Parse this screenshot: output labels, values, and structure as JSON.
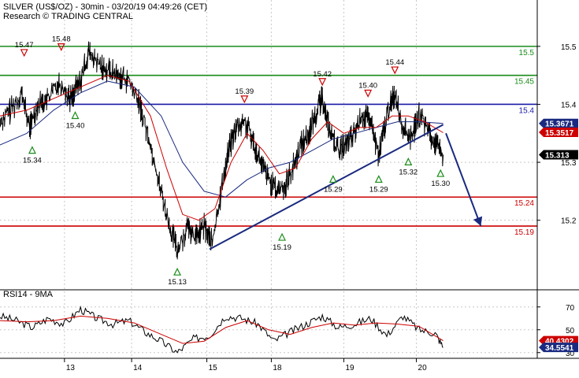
{
  "chart_data": {
    "type": "line",
    "title": "SILVER (US$/OZ) - 30min - 03/20/19 04:49:26 (CET)",
    "subtitle": "Research © TRADING CENTRAL",
    "price_panel": {
      "ylim": [
        15.08,
        15.58
      ],
      "y_ticks": [
        {
          "value": 15.5,
          "label": "15.5"
        },
        {
          "value": 15.4,
          "label": "15.4"
        },
        {
          "value": 15.3,
          "label": "15.3"
        },
        {
          "value": 15.2,
          "label": "15.2"
        }
      ],
      "levels": [
        {
          "value": 15.5,
          "label": "15.5",
          "color": "#1a8c1a"
        },
        {
          "value": 15.45,
          "label": "15.45",
          "color": "#1a8c1a"
        },
        {
          "value": 15.4,
          "label": "15.4",
          "color": "#1a1aa8"
        },
        {
          "value": 15.24,
          "label": "15.24",
          "color": "#cc0000"
        },
        {
          "value": 15.19,
          "label": "15.19",
          "color": "#cc0000"
        }
      ],
      "price_tags": [
        {
          "value": 15.3671,
          "label": "15.3671",
          "bg": "#1a2a80",
          "fg": "#ffffff"
        },
        {
          "value": 15.3517,
          "label": "15.3517",
          "bg": "#cc0000",
          "fg": "#ffffff"
        },
        {
          "value": 15.313,
          "label": "15.313",
          "bg": "#000000",
          "fg": "#ffffff"
        }
      ],
      "annotations": [
        {
          "label": "15.47",
          "type": "high",
          "x": 0.045,
          "price": 15.47
        },
        {
          "label": "15.48",
          "type": "high",
          "x": 0.114,
          "price": 15.48
        },
        {
          "label": "15.40",
          "type": "low",
          "x": 0.14,
          "price": 15.4
        },
        {
          "label": "15.34",
          "type": "low",
          "x": 0.06,
          "price": 15.34
        },
        {
          "label": "15.13",
          "type": "low",
          "x": 0.33,
          "price": 15.13
        },
        {
          "label": "15.39",
          "type": "high",
          "x": 0.455,
          "price": 15.39
        },
        {
          "label": "15.19",
          "type": "low",
          "x": 0.525,
          "price": 15.19
        },
        {
          "label": "15.42",
          "type": "high",
          "x": 0.6,
          "price": 15.42
        },
        {
          "label": "15.29",
          "type": "low",
          "x": 0.62,
          "price": 15.29
        },
        {
          "label": "15.40",
          "type": "high",
          "x": 0.685,
          "price": 15.4
        },
        {
          "label": "15.29",
          "type": "low",
          "x": 0.705,
          "price": 15.29
        },
        {
          "label": "15.44",
          "type": "high",
          "x": 0.735,
          "price": 15.44
        },
        {
          "label": "15.32",
          "type": "low",
          "x": 0.76,
          "price": 15.32
        },
        {
          "label": "15.30",
          "type": "low",
          "x": 0.82,
          "price": 15.3
        }
      ],
      "trendline": {
        "x0": 0.39,
        "p0": 15.15,
        "x1": 0.825,
        "p1": 15.365
      },
      "projection": {
        "x0": 0.83,
        "p0": 15.35,
        "x1": 0.895,
        "p1": 15.19
      },
      "price_series": [
        {
          "x": 0.0,
          "p": 15.37
        },
        {
          "x": 0.02,
          "p": 15.39
        },
        {
          "x": 0.04,
          "p": 15.42
        },
        {
          "x": 0.055,
          "p": 15.36
        },
        {
          "x": 0.07,
          "p": 15.4
        },
        {
          "x": 0.09,
          "p": 15.41
        },
        {
          "x": 0.11,
          "p": 15.44
        },
        {
          "x": 0.13,
          "p": 15.41
        },
        {
          "x": 0.15,
          "p": 15.44
        },
        {
          "x": 0.165,
          "p": 15.49
        },
        {
          "x": 0.18,
          "p": 15.47
        },
        {
          "x": 0.2,
          "p": 15.46
        },
        {
          "x": 0.22,
          "p": 15.45
        },
        {
          "x": 0.24,
          "p": 15.44
        },
        {
          "x": 0.26,
          "p": 15.4
        },
        {
          "x": 0.28,
          "p": 15.33
        },
        {
          "x": 0.3,
          "p": 15.25
        },
        {
          "x": 0.315,
          "p": 15.19
        },
        {
          "x": 0.33,
          "p": 15.15
        },
        {
          "x": 0.35,
          "p": 15.19
        },
        {
          "x": 0.365,
          "p": 15.17
        },
        {
          "x": 0.38,
          "p": 15.19
        },
        {
          "x": 0.395,
          "p": 15.16
        },
        {
          "x": 0.41,
          "p": 15.24
        },
        {
          "x": 0.425,
          "p": 15.32
        },
        {
          "x": 0.44,
          "p": 15.36
        },
        {
          "x": 0.455,
          "p": 15.37
        },
        {
          "x": 0.47,
          "p": 15.34
        },
        {
          "x": 0.485,
          "p": 15.3
        },
        {
          "x": 0.5,
          "p": 15.27
        },
        {
          "x": 0.515,
          "p": 15.25
        },
        {
          "x": 0.53,
          "p": 15.26
        },
        {
          "x": 0.545,
          "p": 15.29
        },
        {
          "x": 0.56,
          "p": 15.33
        },
        {
          "x": 0.575,
          "p": 15.35
        },
        {
          "x": 0.59,
          "p": 15.39
        },
        {
          "x": 0.6,
          "p": 15.41
        },
        {
          "x": 0.615,
          "p": 15.35
        },
        {
          "x": 0.63,
          "p": 15.32
        },
        {
          "x": 0.645,
          "p": 15.33
        },
        {
          "x": 0.66,
          "p": 15.35
        },
        {
          "x": 0.675,
          "p": 15.38
        },
        {
          "x": 0.69,
          "p": 15.37
        },
        {
          "x": 0.705,
          "p": 15.31
        },
        {
          "x": 0.72,
          "p": 15.38
        },
        {
          "x": 0.735,
          "p": 15.42
        },
        {
          "x": 0.75,
          "p": 15.36
        },
        {
          "x": 0.765,
          "p": 15.34
        },
        {
          "x": 0.78,
          "p": 15.38
        },
        {
          "x": 0.795,
          "p": 15.36
        },
        {
          "x": 0.81,
          "p": 15.33
        },
        {
          "x": 0.825,
          "p": 15.313
        }
      ],
      "ma_red": [
        {
          "x": 0.0,
          "p": 15.38
        },
        {
          "x": 0.05,
          "p": 15.39
        },
        {
          "x": 0.1,
          "p": 15.41
        },
        {
          "x": 0.15,
          "p": 15.43
        },
        {
          "x": 0.2,
          "p": 15.45
        },
        {
          "x": 0.24,
          "p": 15.44
        },
        {
          "x": 0.28,
          "p": 15.38
        },
        {
          "x": 0.31,
          "p": 15.29
        },
        {
          "x": 0.34,
          "p": 15.21
        },
        {
          "x": 0.37,
          "p": 15.2
        },
        {
          "x": 0.4,
          "p": 15.22
        },
        {
          "x": 0.43,
          "p": 15.3
        },
        {
          "x": 0.46,
          "p": 15.35
        },
        {
          "x": 0.49,
          "p": 15.32
        },
        {
          "x": 0.52,
          "p": 15.28
        },
        {
          "x": 0.55,
          "p": 15.29
        },
        {
          "x": 0.58,
          "p": 15.34
        },
        {
          "x": 0.61,
          "p": 15.37
        },
        {
          "x": 0.64,
          "p": 15.35
        },
        {
          "x": 0.67,
          "p": 15.36
        },
        {
          "x": 0.7,
          "p": 15.36
        },
        {
          "x": 0.73,
          "p": 15.38
        },
        {
          "x": 0.76,
          "p": 15.38
        },
        {
          "x": 0.79,
          "p": 15.37
        },
        {
          "x": 0.825,
          "p": 15.351
        }
      ],
      "ma_blue": [
        {
          "x": 0.0,
          "p": 15.33
        },
        {
          "x": 0.05,
          "p": 15.35
        },
        {
          "x": 0.1,
          "p": 15.39
        },
        {
          "x": 0.15,
          "p": 15.42
        },
        {
          "x": 0.2,
          "p": 15.44
        },
        {
          "x": 0.25,
          "p": 15.43
        },
        {
          "x": 0.3,
          "p": 15.38
        },
        {
          "x": 0.34,
          "p": 15.3
        },
        {
          "x": 0.38,
          "p": 15.25
        },
        {
          "x": 0.42,
          "p": 15.24
        },
        {
          "x": 0.46,
          "p": 15.27
        },
        {
          "x": 0.5,
          "p": 15.29
        },
        {
          "x": 0.54,
          "p": 15.3
        },
        {
          "x": 0.58,
          "p": 15.32
        },
        {
          "x": 0.62,
          "p": 15.34
        },
        {
          "x": 0.66,
          "p": 15.35
        },
        {
          "x": 0.7,
          "p": 15.36
        },
        {
          "x": 0.74,
          "p": 15.37
        },
        {
          "x": 0.78,
          "p": 15.37
        },
        {
          "x": 0.825,
          "p": 15.367
        }
      ]
    },
    "rsi_panel": {
      "label": "RSI14 - 9MA",
      "ylim": [
        25,
        85
      ],
      "y_ticks": [
        {
          "value": 70,
          "label": "70"
        },
        {
          "value": 50,
          "label": "50"
        },
        {
          "value": 30,
          "label": "30"
        }
      ],
      "price_tags": [
        {
          "value": 40.4302,
          "label": "40.4302",
          "bg": "#cc0000",
          "fg": "#ffffff"
        },
        {
          "value": 34.5541,
          "label": "34.5541",
          "bg": "#1a2a80",
          "fg": "#ffffff"
        }
      ],
      "rsi_series": [
        {
          "x": 0.0,
          "v": 62
        },
        {
          "x": 0.03,
          "v": 58
        },
        {
          "x": 0.06,
          "v": 52
        },
        {
          "x": 0.09,
          "v": 60
        },
        {
          "x": 0.12,
          "v": 55
        },
        {
          "x": 0.15,
          "v": 68
        },
        {
          "x": 0.18,
          "v": 60
        },
        {
          "x": 0.21,
          "v": 55
        },
        {
          "x": 0.24,
          "v": 58
        },
        {
          "x": 0.27,
          "v": 48
        },
        {
          "x": 0.3,
          "v": 40
        },
        {
          "x": 0.33,
          "v": 30
        },
        {
          "x": 0.36,
          "v": 42
        },
        {
          "x": 0.39,
          "v": 45
        },
        {
          "x": 0.42,
          "v": 62
        },
        {
          "x": 0.45,
          "v": 60
        },
        {
          "x": 0.48,
          "v": 55
        },
        {
          "x": 0.51,
          "v": 40
        },
        {
          "x": 0.54,
          "v": 48
        },
        {
          "x": 0.57,
          "v": 55
        },
        {
          "x": 0.6,
          "v": 62
        },
        {
          "x": 0.63,
          "v": 52
        },
        {
          "x": 0.66,
          "v": 55
        },
        {
          "x": 0.69,
          "v": 60
        },
        {
          "x": 0.72,
          "v": 45
        },
        {
          "x": 0.75,
          "v": 62
        },
        {
          "x": 0.78,
          "v": 50
        },
        {
          "x": 0.81,
          "v": 47
        },
        {
          "x": 0.825,
          "v": 34.55
        }
      ],
      "ma_series": [
        {
          "x": 0.0,
          "v": 58
        },
        {
          "x": 0.05,
          "v": 57
        },
        {
          "x": 0.1,
          "v": 58
        },
        {
          "x": 0.15,
          "v": 62
        },
        {
          "x": 0.2,
          "v": 60
        },
        {
          "x": 0.25,
          "v": 56
        },
        {
          "x": 0.3,
          "v": 46
        },
        {
          "x": 0.34,
          "v": 38
        },
        {
          "x": 0.38,
          "v": 40
        },
        {
          "x": 0.42,
          "v": 52
        },
        {
          "x": 0.46,
          "v": 58
        },
        {
          "x": 0.5,
          "v": 50
        },
        {
          "x": 0.54,
          "v": 46
        },
        {
          "x": 0.58,
          "v": 52
        },
        {
          "x": 0.62,
          "v": 56
        },
        {
          "x": 0.66,
          "v": 54
        },
        {
          "x": 0.7,
          "v": 56
        },
        {
          "x": 0.74,
          "v": 55
        },
        {
          "x": 0.78,
          "v": 53
        },
        {
          "x": 0.825,
          "v": 40.43
        }
      ]
    },
    "x_axis": {
      "ticks": [
        {
          "x": 0.12,
          "label": "13"
        },
        {
          "x": 0.245,
          "label": "14"
        },
        {
          "x": 0.385,
          "label": "15"
        },
        {
          "x": 0.505,
          "label": "18"
        },
        {
          "x": 0.64,
          "label": "19"
        },
        {
          "x": 0.775,
          "label": "20"
        }
      ]
    },
    "colors": {
      "price": "#000000",
      "ma_red": "#cc0000",
      "ma_blue": "#1a2a80",
      "trend": "#1a2a80",
      "rsi": "#000000",
      "rsi_ma": "#cc0000",
      "grid": "#c8c8c8"
    }
  }
}
